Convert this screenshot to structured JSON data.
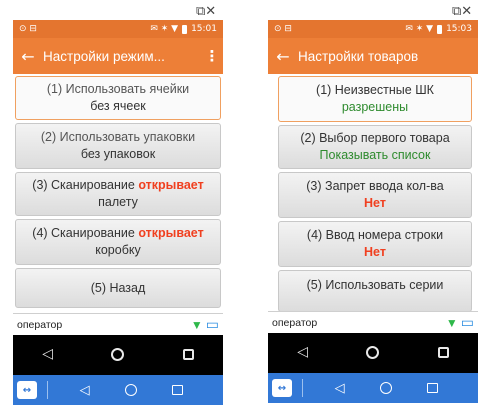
{
  "window_controls": {
    "left": "⧉✕",
    "right": "⧉✕"
  },
  "screens": [
    {
      "status": {
        "left_icons": "⊙ ⊟",
        "right_icons": "✉ ✶ ▼",
        "time": "15:01"
      },
      "appbar": {
        "back": "←",
        "title": "Настройки режим...",
        "menu": "⋮"
      },
      "buttons": [
        {
          "line1": "(1) Использовать ячейки",
          "line2": "без ячеек"
        },
        {
          "line1": "(2) Использовать упаковки",
          "line2": "без упаковок"
        },
        {
          "line1_prefix": "(3) Сканирование ",
          "line1_red": "открывает",
          "line2": "палету"
        },
        {
          "line1_prefix": "(4) Сканирование ",
          "line1_red": "открывает",
          "line2": "коробку"
        },
        {
          "line1": "(5) Назад"
        }
      ],
      "bottom": {
        "operator": "оператор",
        "wifi": "▼",
        "screen": "▭"
      },
      "nav": {
        "back": "◁"
      },
      "host": {
        "icon": "↔",
        "back": "◁"
      }
    },
    {
      "status": {
        "left_icons": "⊙ ⊟",
        "right_icons": "✉ ✶ ▼",
        "time": "15:03"
      },
      "appbar": {
        "back": "←",
        "title": "Настройки товаров"
      },
      "buttons": [
        {
          "line1": "(1) Неизвестные ШК",
          "line2": "разрешены"
        },
        {
          "line1": "(2) Выбор первого товара",
          "line2": "Показывать список"
        },
        {
          "line1": "(3) Запрет ввода кол-ва",
          "line2": "Нет"
        },
        {
          "line1": "(4) Ввод номера строки",
          "line2": "Нет"
        },
        {
          "line1": "(5) Использовать серии"
        }
      ],
      "bottom": {
        "operator": "оператор",
        "wifi": "▼",
        "screen": "▭"
      },
      "nav": {
        "back": "◁"
      },
      "host": {
        "icon": "↔",
        "back": "◁"
      }
    }
  ]
}
